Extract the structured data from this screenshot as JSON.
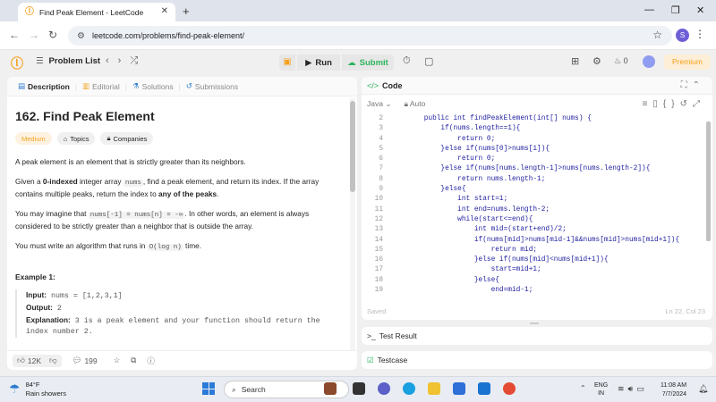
{
  "browser": {
    "tab_title": "Find Peak Element - LeetCode",
    "url": "leetcode.com/problems/find-peak-element/",
    "profile_initial": "S"
  },
  "lc_nav": {
    "problem_list": "Problem List",
    "run": "Run",
    "submit": "Submit",
    "streak": "0",
    "premium": "Premium"
  },
  "left_tabs": {
    "description": "Description",
    "editorial": "Editorial",
    "solutions": "Solutions",
    "submissions": "Submissions"
  },
  "problem": {
    "title": "162. Find Peak Element",
    "difficulty": "Medium",
    "topics": "Topics",
    "companies": "Companies",
    "p1": "A peak element is an element that is strictly greater than its neighbors.",
    "p2_a": "Given a ",
    "p2_b": "0-indexed",
    "p2_c": " integer array ",
    "p2_code": "nums",
    "p2_d": ", find a peak element, and return its index. If the array contains multiple peaks, return the index to ",
    "p2_e": "any of the peaks",
    "p2_f": ".",
    "p3_a": "You may imagine that ",
    "p3_code1": "nums[-1] = nums[n] = -∞",
    "p3_b": ". In other words, an element is always considered to be strictly greater than a neighbor that is outside the array.",
    "p4_a": "You must write an algorithm that runs in ",
    "p4_code": "O(log n)",
    "p4_b": " time.",
    "example_title": "Example 1:",
    "input_label": "Input:",
    "input_value": " nums = [1,2,3,1]",
    "output_label": "Output:",
    "output_value": " 2",
    "explanation_label": "Explanation:",
    "explanation_value": " 3 is a peak element and your function should return the index number 2."
  },
  "bottom_bar": {
    "likes": "12K",
    "comments": "199"
  },
  "code_panel": {
    "title": "Code",
    "language": "Java",
    "mode": "Auto",
    "status": "Saved",
    "cursor": "Ln 22, Col 23",
    "lines": [
      {
        "n": "2",
        "code": "    public int findPeakElement(int[] nums) {"
      },
      {
        "n": "3",
        "code": "        if(nums.length==1){"
      },
      {
        "n": "4",
        "code": "            return 0;"
      },
      {
        "n": "5",
        "code": "        }else if(nums[0]>nums[1]){"
      },
      {
        "n": "6",
        "code": "            return 0;"
      },
      {
        "n": "7",
        "code": "        }else if(nums[nums.length-1]>nums[nums.length-2]){"
      },
      {
        "n": "8",
        "code": "            return nums.length-1;"
      },
      {
        "n": "9",
        "code": "        }else{"
      },
      {
        "n": "10",
        "code": "            int start=1;"
      },
      {
        "n": "11",
        "code": "            int end=nums.length-2;"
      },
      {
        "n": "12",
        "code": "            while(start<=end){"
      },
      {
        "n": "13",
        "code": "                int mid=(start+end)/2;"
      },
      {
        "n": "14",
        "code": "                if(nums[mid]>nums[mid-1]&&nums[mid]>nums[mid+1]){"
      },
      {
        "n": "15",
        "code": "                    return mid;"
      },
      {
        "n": "16",
        "code": "                }else if(nums[mid]<nums[mid+1]){"
      },
      {
        "n": "17",
        "code": "                    start=mid+1;"
      },
      {
        "n": "18",
        "code": "                }else{"
      },
      {
        "n": "19",
        "code": "                    end=mid-1;"
      }
    ]
  },
  "test_result": "Test Result",
  "testcase": "Testcase",
  "taskbar": {
    "temp": "84°F",
    "weather": "Rain showers",
    "search": "Search",
    "lang1": "ENG",
    "lang2": "IN",
    "time": "11:08 AM",
    "date": "7/7/2024"
  },
  "colors": {
    "accent": "#f89f1b",
    "success": "#2db55d",
    "medium": "#f0a420"
  }
}
